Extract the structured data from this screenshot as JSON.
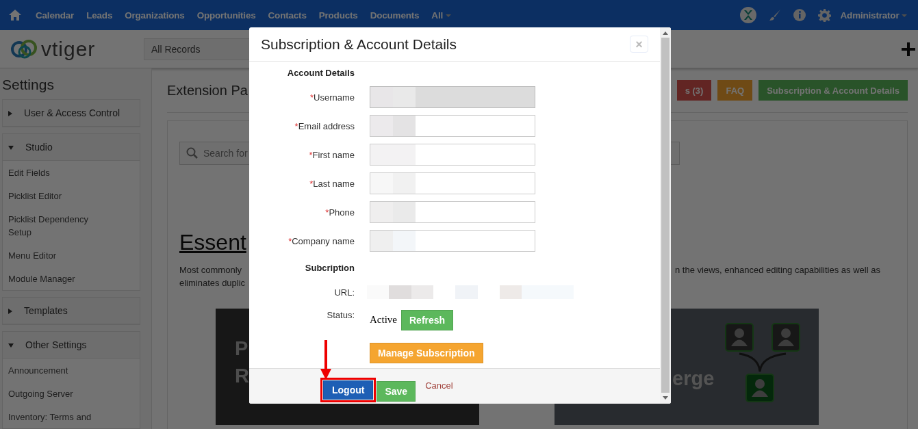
{
  "nav": {
    "items": [
      "Calendar",
      "Leads",
      "Organizations",
      "Opportunities",
      "Contacts",
      "Products",
      "Documents"
    ],
    "more": "All",
    "user": "Administrator"
  },
  "header": {
    "logo": "vtiger",
    "list_select": "All Records"
  },
  "sidebar": {
    "title": "Settings",
    "groups": [
      {
        "label": "User & Access Control",
        "expanded": false
      },
      {
        "label": "Studio",
        "expanded": true,
        "children": [
          "Edit Fields",
          "Picklist Editor",
          "Picklist Dependency Setup",
          "Menu Editor",
          "Module Manager"
        ]
      },
      {
        "label": "Templates",
        "expanded": false
      },
      {
        "label": "Other Settings",
        "expanded": true,
        "children": [
          "Announcement",
          "Outgoing Server",
          "Inventory: Terms and"
        ]
      }
    ]
  },
  "main": {
    "title": "Extension Pa",
    "actions": [
      {
        "label": "s (3)",
        "kind": "danger"
      },
      {
        "label": "FAQ",
        "kind": "warning"
      },
      {
        "label": "Subscription & Account Details",
        "kind": "success"
      }
    ],
    "search": {
      "placeholder": "Search for"
    },
    "heading": "Essent",
    "text_left": [
      "Most commonly",
      "eliminates duplic"
    ],
    "text_right": "n the views, enhanced editing capabilities as well as",
    "cards": [
      {
        "kind": "promo",
        "lines": [
          "P",
          "R"
        ]
      },
      {
        "kind": "merge",
        "title": "erge"
      }
    ]
  },
  "modal": {
    "title": "Subscription & Account Details",
    "close": "×",
    "account_heading": "Account Details",
    "required_mark": "*",
    "fields": [
      {
        "label": "Username",
        "required": true,
        "disabled": true
      },
      {
        "label": "Email address",
        "required": true,
        "disabled": false
      },
      {
        "label": "First name",
        "required": true,
        "disabled": false
      },
      {
        "label": "Last name",
        "required": true,
        "disabled": false
      },
      {
        "label": "Phone",
        "required": true,
        "disabled": false
      },
      {
        "label": "Company name",
        "required": true,
        "disabled": false
      }
    ],
    "subscription_heading": "Subcription",
    "url_label": "URL:",
    "status_label": "Status:",
    "status": "Active",
    "refresh": "Refresh",
    "manage": "Manage Subscription",
    "footer": [
      {
        "label": "Logout",
        "kind": "primary",
        "highlighted": true
      },
      {
        "label": "Save",
        "kind": "success",
        "highlighted": false
      },
      {
        "label": "Cancel",
        "kind": "link",
        "highlighted": false
      }
    ]
  }
}
